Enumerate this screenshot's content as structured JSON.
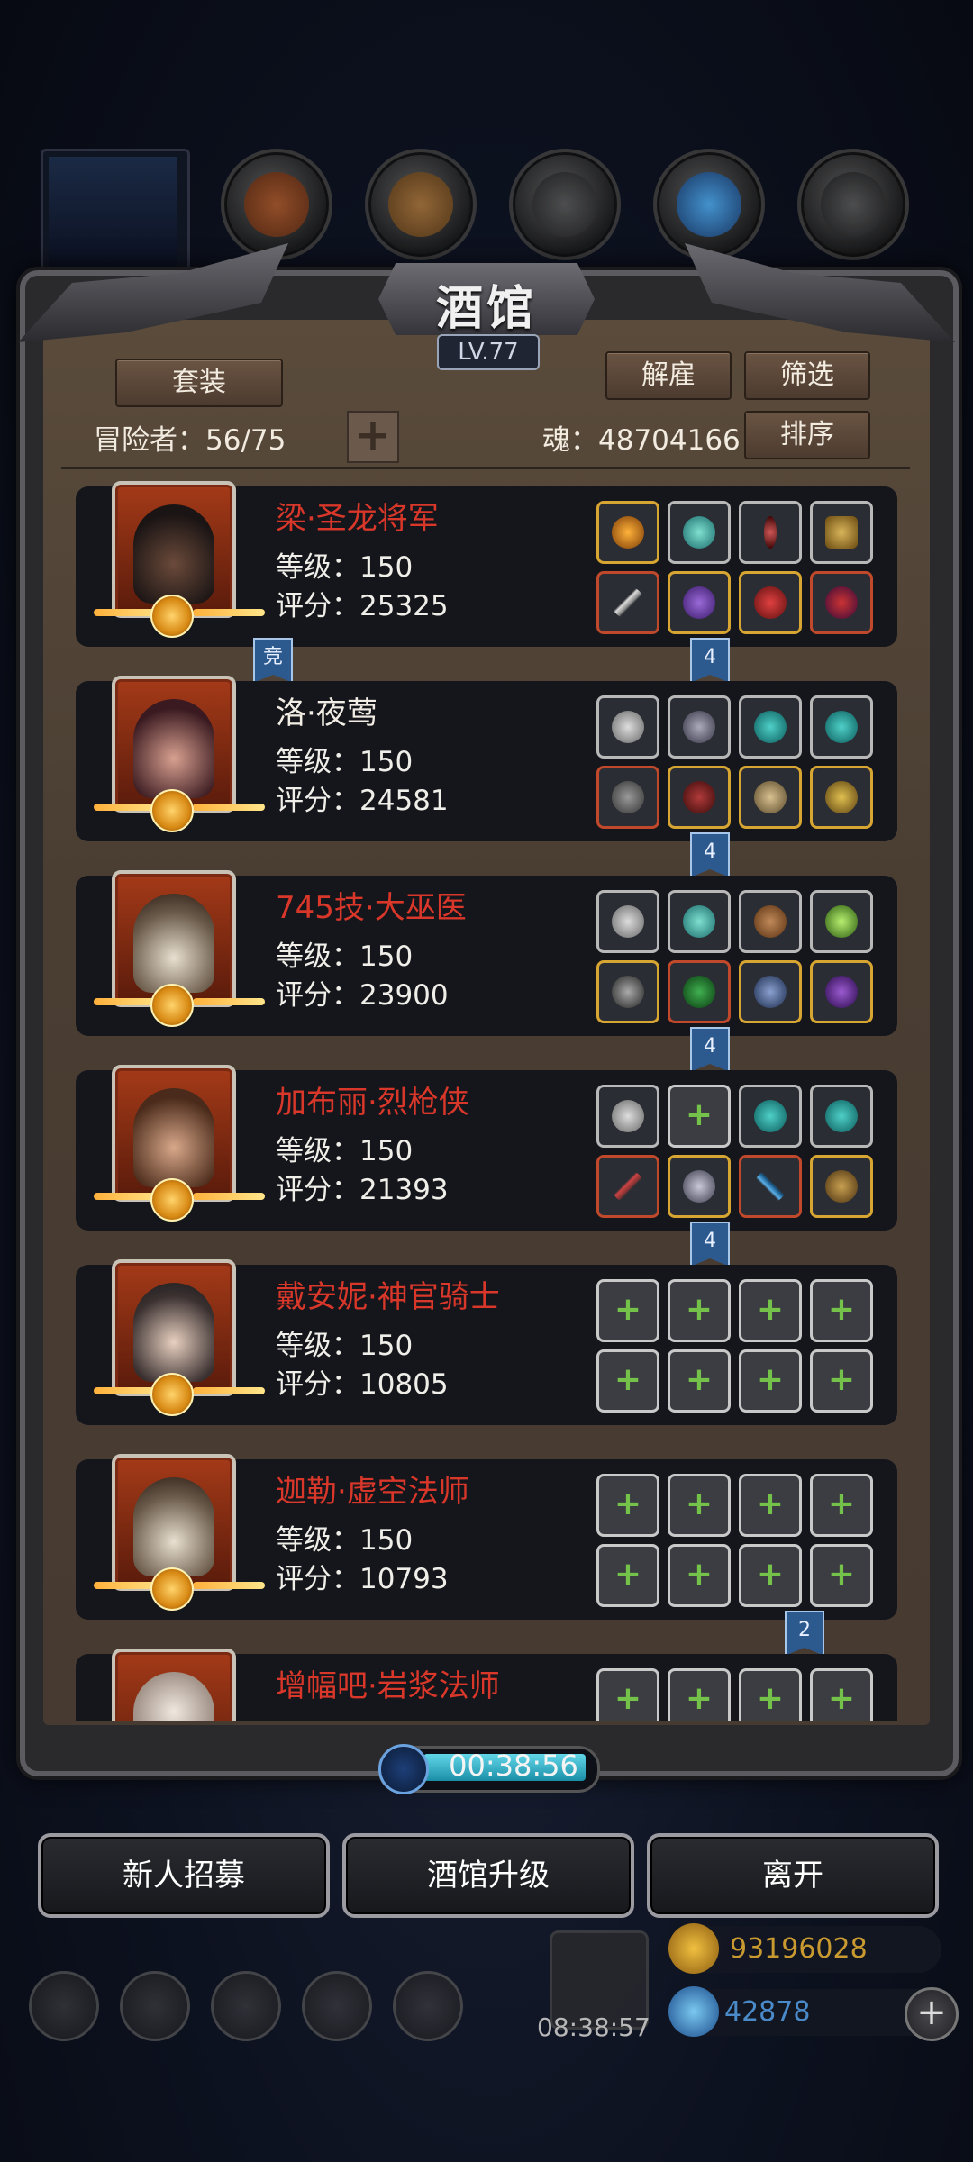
{
  "panel": {
    "title": "酒馆",
    "level": "LV.77",
    "set_button": "套装",
    "dismiss_button": "解雇",
    "filter_button": "筛选",
    "sort_button": "排序",
    "adventurer_label": "冒险者：56/75",
    "soul_label": "魂：48704166"
  },
  "adventurers": [
    {
      "name": "梁·圣龙将军",
      "level": "等级：150",
      "score": "评分：25325",
      "name_color": "#d8372a"
    },
    {
      "name": "洛·夜莺",
      "level": "等级：150",
      "score": "评分：24581",
      "name_color": "#f2ede4"
    },
    {
      "name": "745技·大巫医",
      "level": "等级：150",
      "score": "评分：23900",
      "name_color": "#d8372a"
    },
    {
      "name": "加布丽·烈枪侠",
      "level": "等级：150",
      "score": "评分：21393",
      "name_color": "#d8372a"
    },
    {
      "name": "戴安妮·神官骑士",
      "level": "等级：150",
      "score": "评分：10805",
      "name_color": "#d8372a"
    },
    {
      "name": "迦勒·虚空法师",
      "level": "等级：150",
      "score": "评分：10793",
      "name_color": "#d8372a"
    },
    {
      "name": "增幅吧·岩浆法师",
      "name_color": "#d8372a"
    }
  ],
  "tags": {
    "arena": "竞",
    "four": "4",
    "two": "2"
  },
  "timer": "00:38:56",
  "bottom_buttons": {
    "recruit": "新人招募",
    "upgrade": "酒馆升级",
    "leave": "离开"
  },
  "hud": {
    "gift_timer": "08:38:57",
    "gold": "93196028",
    "diamonds": "42878",
    "add": "+"
  },
  "colors": {
    "parchment": "#4a3e33",
    "name_red": "#d8372a",
    "tag_blue": "#2d5a8e",
    "timer_cyan": "#62d6e8"
  }
}
